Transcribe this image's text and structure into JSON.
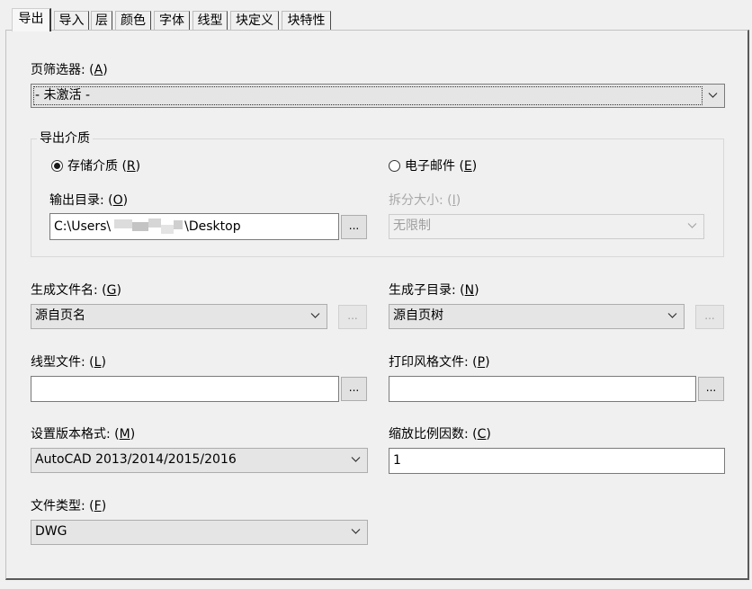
{
  "tabs": [
    {
      "label": "导出",
      "active": true
    },
    {
      "label": "导入",
      "active": false
    },
    {
      "label": "层",
      "active": false
    },
    {
      "label": "颜色",
      "active": false
    },
    {
      "label": "字体",
      "active": false
    },
    {
      "label": "线型",
      "active": false
    },
    {
      "label": "块定义",
      "active": false
    },
    {
      "label": "块特性",
      "active": false
    }
  ],
  "page_filter": {
    "label": "页筛选器: (",
    "key": "A",
    "label_end": ")",
    "value": "- 未激活 -"
  },
  "export_media": {
    "title": "导出介质",
    "storage": {
      "label": "存储介质 (",
      "key": "R",
      "label_end": ")",
      "selected": true
    },
    "email": {
      "label": "电子邮件 (",
      "key": "E",
      "label_end": ")",
      "selected": false
    },
    "output_dir": {
      "label": "输出目录: (",
      "key": "O",
      "label_end": ")",
      "value_prefix": "C:\\Users\\",
      "value_suffix": "\\Desktop",
      "browse": "..."
    },
    "split_size": {
      "label": "拆分大小: (",
      "key": "I",
      "label_end": ")",
      "value": "无限制",
      "disabled": true
    }
  },
  "gen_filename": {
    "label": "生成文件名: (",
    "key": "G",
    "label_end": ")",
    "value": "源自页名",
    "browse": "..."
  },
  "gen_subdir": {
    "label": "生成子目录: (",
    "key": "N",
    "label_end": ")",
    "value": "源自页树",
    "browse": "..."
  },
  "linetype_file": {
    "label": "线型文件: (",
    "key": "L",
    "label_end": ")",
    "value": "",
    "browse": "..."
  },
  "plotstyle_file": {
    "label": "打印风格文件: (",
    "key": "P",
    "label_end": ")",
    "value": "",
    "browse": "..."
  },
  "version_format": {
    "label": "设置版本格式: (",
    "key": "M",
    "label_end": ")",
    "value": "AutoCAD 2013/2014/2015/2016"
  },
  "scale_factor": {
    "label": "缩放比例因数: (",
    "key": "C",
    "label_end": ")",
    "value": "1"
  },
  "file_type": {
    "label": "文件类型: (",
    "key": "F",
    "label_end": ")",
    "value": "DWG"
  }
}
